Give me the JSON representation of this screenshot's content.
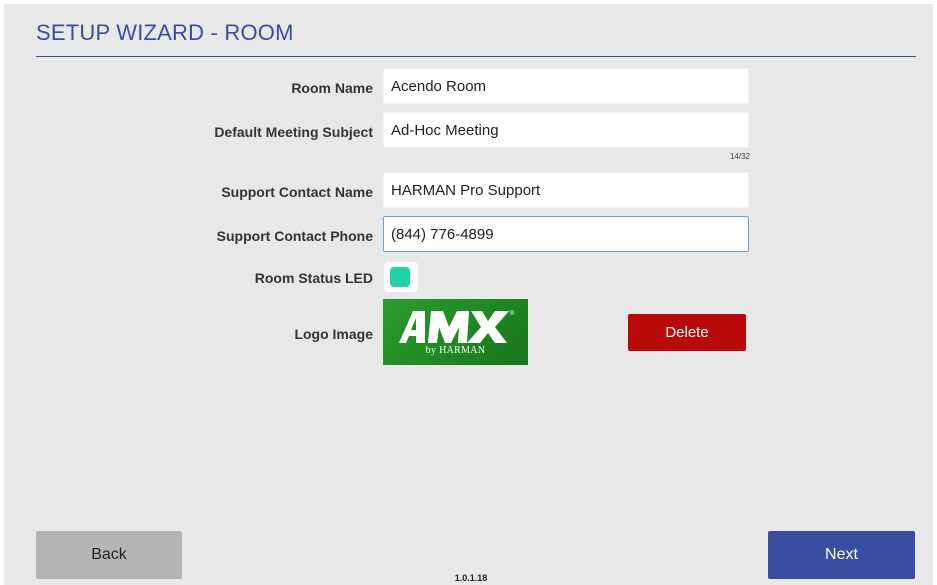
{
  "page": {
    "title": "SETUP WIZARD - ROOM",
    "version": "1.0.1.18"
  },
  "form": {
    "room_name": {
      "label": "Room Name",
      "value": "Acendo Room"
    },
    "meeting_subject": {
      "label": "Default Meeting Subject",
      "value": "Ad-Hoc Meeting",
      "counter": "14/32"
    },
    "support_name": {
      "label": "Support Contact Name",
      "value": "HARMAN Pro Support"
    },
    "support_phone": {
      "label": "Support Contact Phone",
      "value": "(844) 776-4899"
    },
    "room_led": {
      "label": "Room Status LED",
      "color": "#1fd3a6"
    },
    "logo": {
      "label": "Logo Image",
      "brand_text": "AMX",
      "sub_text": "by HARMAN",
      "delete_label": "Delete"
    }
  },
  "nav": {
    "back_label": "Back",
    "next_label": "Next"
  },
  "colors": {
    "accent": "#3a4ea0",
    "delete": "#b80a0a",
    "back_button": "#b4b4b4",
    "logo_green": "#208a24"
  }
}
